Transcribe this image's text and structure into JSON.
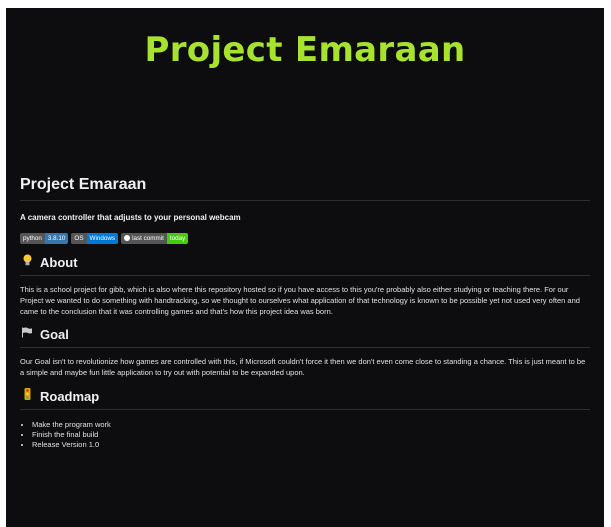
{
  "hero": {
    "title": "Project Emaraan"
  },
  "readme": {
    "title": "Project Emaraan",
    "subtitle": "A camera controller that adjusts to your personal webcam",
    "badges": [
      {
        "label": "python",
        "value": "3.8.10",
        "color": "#3776ab"
      },
      {
        "label": "OS",
        "value": "Windows",
        "color": "#0078d6"
      },
      {
        "label": "last commit",
        "value": "today",
        "color": "#44cc11",
        "icon": "github-icon"
      }
    ],
    "sections": {
      "about": {
        "icon": "lightbulb-icon",
        "heading": "About",
        "text": "This is a school project for gibb, which is also where this repository hosted so if you have access to this you're probably also either studying or teaching there. For our Project we wanted to do something with handtracking, so we thought to ourselves what application of that technology is known to be possible yet not used very often and came to the conclusion that it was controlling games and that's how this project idea was born."
      },
      "goal": {
        "icon": "flag-icon",
        "heading": "Goal",
        "text": "Our Goal isn't to revolutionize how games are controlled with this, if Microsoft couldn't force it then we don't even come close to standing a chance. This is just meant to be a simple and maybe fun little application to try out with potential to be expanded upon."
      },
      "roadmap": {
        "icon": "traffic-light-icon",
        "heading": "Roadmap",
        "items": [
          "Make the program work",
          "Finish the final build",
          "Release Version 1.0"
        ]
      }
    }
  },
  "colors": {
    "background": "#0d0d0f",
    "hero_accent": "#a6e22e",
    "text": "#e2e2e2"
  }
}
